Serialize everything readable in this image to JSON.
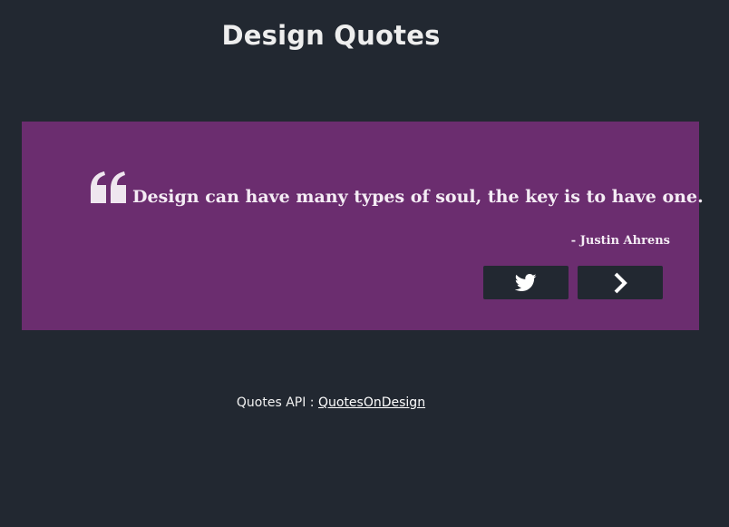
{
  "header": {
    "title": "Design Quotes"
  },
  "quote": {
    "icon": "quote-left-icon",
    "text": "Design can have many types of soul, the key is to have one.",
    "author": "- Justin Ahrens"
  },
  "actions": {
    "tweet_icon": "twitter-icon",
    "next_icon": "chevron-right-icon"
  },
  "footer": {
    "prefix": "Quotes API : ",
    "link_text": "QuotesOnDesign"
  },
  "colors": {
    "background": "#222831",
    "card": "#6b2d6f",
    "button": "#222831",
    "text": "#f2f2f2"
  }
}
